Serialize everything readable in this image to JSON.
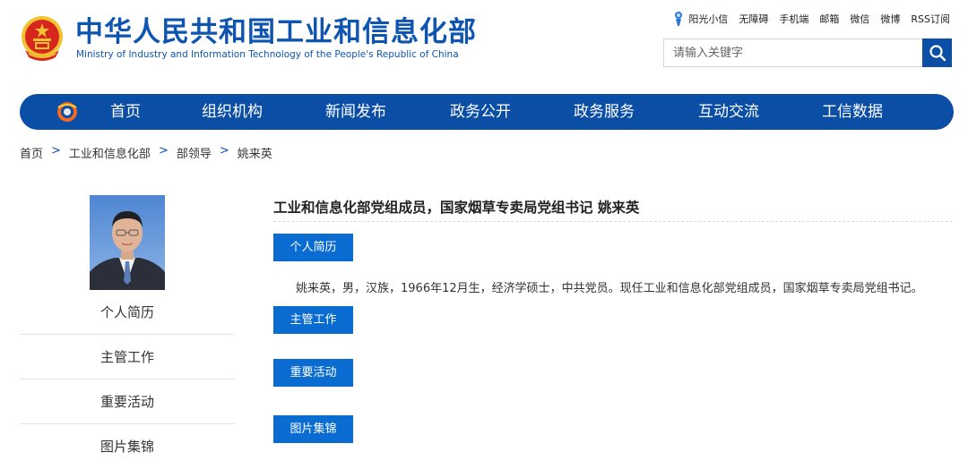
{
  "header": {
    "title": "中华人民共和国工业和信息化部",
    "subtitle": "Ministry of Industry and Information Technology of the People's Republic of China",
    "top_links": [
      "阳光小信",
      "无障碍",
      "手机端",
      "邮箱",
      "微信",
      "微博",
      "RSS订阅"
    ],
    "search_placeholder": "请输入关键字"
  },
  "nav": {
    "items": [
      "首页",
      "组织机构",
      "新闻发布",
      "政务公开",
      "政务服务",
      "互动交流",
      "工信数据"
    ]
  },
  "breadcrumb": {
    "items": [
      "首页",
      "工业和信息化部",
      "部领导",
      "姚来英"
    ],
    "separator": ">"
  },
  "sidebar": {
    "items": [
      "个人简历",
      "主管工作",
      "重要活动",
      "图片集锦"
    ]
  },
  "profile": {
    "title": "工业和信息化部党组成员，国家烟草专卖局党组书记  姚来英",
    "sections": [
      "个人简历",
      "主管工作",
      "重要活动",
      "图片集锦"
    ],
    "bio": "姚来英，男，汉族，1966年12月生，经济学硕士，中共党员。现任工业和信息化部党组成员，国家烟草专卖局党组书记。"
  },
  "colors": {
    "brand_blue": "#0a4ea5",
    "button_blue": "#0a6bd0",
    "emblem_red": "#d7261e",
    "emblem_gold": "#f2c230"
  }
}
